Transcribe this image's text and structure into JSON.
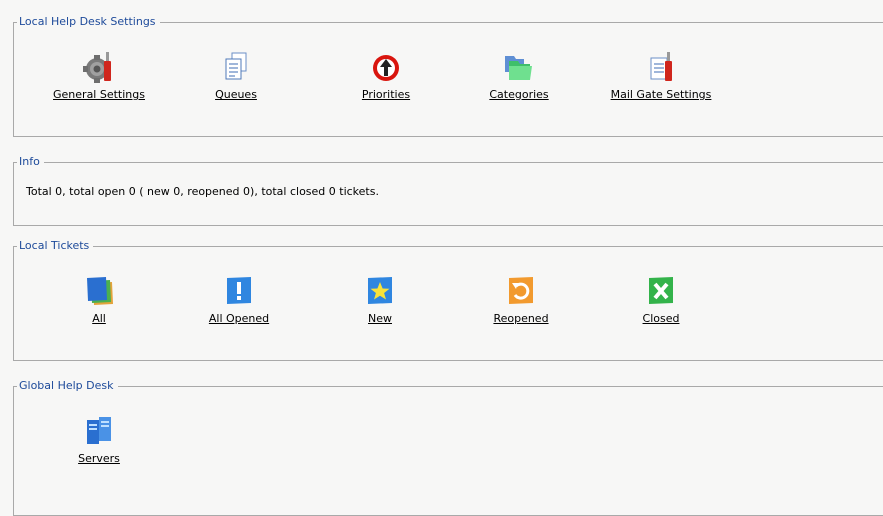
{
  "groups": {
    "local_settings": {
      "title": "Local Help Desk Settings",
      "items": [
        {
          "label": "General Settings",
          "icon": "settings-gear-icon"
        },
        {
          "label": "Queues",
          "icon": "documents-icon"
        },
        {
          "label": "Priorities",
          "icon": "priority-arrow-icon"
        },
        {
          "label": "Categories",
          "icon": "folders-icon"
        },
        {
          "label": "Mail Gate Settings",
          "icon": "mail-gate-icon"
        }
      ]
    },
    "info": {
      "title": "Info",
      "text": "Total 0, total open 0 ( new 0, reopened 0), total closed 0 tickets."
    },
    "local_tickets": {
      "title": "Local Tickets",
      "items": [
        {
          "label": "All",
          "icon": "tickets-stack-icon"
        },
        {
          "label": "All Opened",
          "icon": "exclamation-ticket-icon"
        },
        {
          "label": "New",
          "icon": "star-ticket-icon"
        },
        {
          "label": "Reopened",
          "icon": "reopen-ticket-icon"
        },
        {
          "label": "Closed",
          "icon": "closed-ticket-icon"
        }
      ]
    },
    "global": {
      "title": "Global Help Desk",
      "items": [
        {
          "label": "Servers",
          "icon": "servers-icon"
        }
      ]
    }
  },
  "colors": {
    "legend_text": "#1d4a9a",
    "border": "#a9a9a9",
    "background": "#f7f7f6"
  }
}
